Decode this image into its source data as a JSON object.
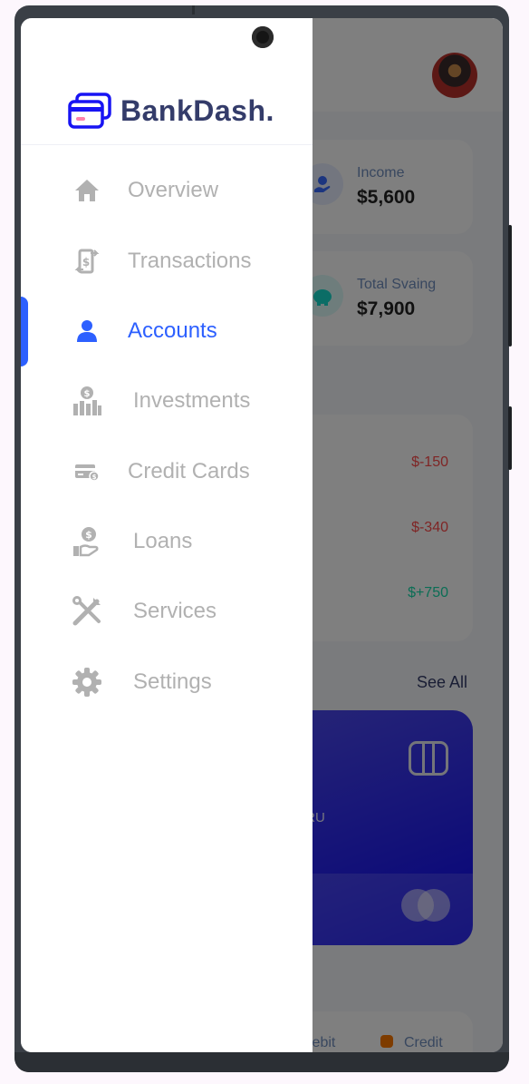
{
  "app": {
    "brand": "BankDash."
  },
  "drawer": {
    "items": [
      {
        "label": "Overview",
        "icon": "home-icon",
        "active": false
      },
      {
        "label": "Transactions",
        "icon": "transfer-icon",
        "active": false
      },
      {
        "label": "Accounts",
        "icon": "user-icon",
        "active": true
      },
      {
        "label": "Investments",
        "icon": "investment-icon",
        "active": false
      },
      {
        "label": "Credit Cards",
        "icon": "credit-card-icon",
        "active": false
      },
      {
        "label": "Loans",
        "icon": "loan-icon",
        "active": false
      },
      {
        "label": "Services",
        "icon": "tools-icon",
        "active": false
      },
      {
        "label": "Settings",
        "icon": "gear-icon",
        "active": false
      }
    ]
  },
  "background": {
    "stats": [
      {
        "label": "Income",
        "value": "$5,600",
        "icon": "income-icon"
      },
      {
        "label": "Total Svaing",
        "value": "$7,900",
        "icon": "piggy-bank-icon"
      }
    ],
    "transactions": [
      {
        "amount": "$-150",
        "color": "#ff4b4a"
      },
      {
        "amount": "$-340",
        "color": "#ff4b4a"
      },
      {
        "amount": "$+750",
        "color": "#16dbaa"
      }
    ],
    "see_all": "See All",
    "card": {
      "partial_text": "IRU"
    },
    "legend": [
      {
        "label": "Debit",
        "color": "#1a16f3"
      },
      {
        "label": "Credit",
        "color": "#fc7900"
      }
    ]
  },
  "colors": {
    "accent": "#2d60ff",
    "brand_text": "#343c6a",
    "inactive": "#b1b1b1"
  }
}
